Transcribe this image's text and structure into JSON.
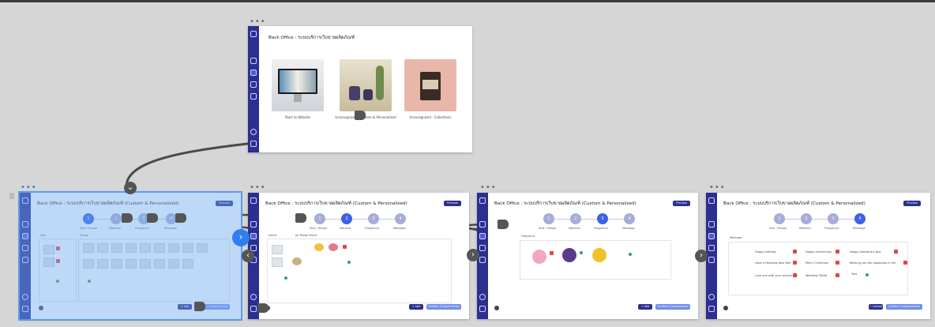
{
  "canvas": {
    "menu_glyph": "•••",
    "next_glyph": "›",
    "back_glyph": "‹",
    "down_glyph": "⌄"
  },
  "top_card": {
    "title": "Back Office : ระบบบริการเว็บขายผลิตภัณฑ์",
    "products": [
      {
        "label": "Start to Website"
      },
      {
        "label": "Unrecognized · Custom & Personalized"
      },
      {
        "label": "Unrecognized · Collections"
      }
    ]
  },
  "flow_cards": [
    {
      "title": "Back Office : ระบบบริการเว็บขายผลิตภัณฑ์ (Custom & Personalized)",
      "button": "Preview",
      "active_step": 1,
      "section_a": "Size",
      "section_b": "Shape",
      "actions": [
        "+ Add",
        "Confirm Customization"
      ]
    },
    {
      "title": "Back Office : ระบบบริการเว็บขายผลิตภัณฑ์ (Custom & Personalized)",
      "button": "Preview",
      "active_step": 2,
      "section_a": "Select",
      "section_b": "Jar Pastel Mood",
      "actions": [
        "+ Add",
        "Confirm Customization"
      ]
    },
    {
      "title": "Back Office : ระบบบริการเว็บขายผลิตภัณฑ์ (Custom & Personalized)",
      "button": "Preview",
      "active_step": 3,
      "section_a": "Fragrance",
      "section_b": "",
      "actions": [
        "+ Add",
        "Confirm Customization"
      ]
    },
    {
      "title": "Back Office : ระบบบริการเว็บขายผลิตภัณฑ์ (Custom & Personalized)",
      "button": "Preview",
      "active_step": 4,
      "section_a": "Message",
      "section_b": "",
      "messages": [
        "Happy birthday",
        "Happy Anniversary",
        "Happy Valentine's Day",
        "Have a Relaxing New Year",
        "Merry Christmas",
        "Wishing you the happiness in life",
        "Love you with your special day",
        "Wedding Gifted",
        "Text"
      ],
      "actions": [
        "+ Upload",
        "Confirm Customization"
      ]
    }
  ],
  "steps": [
    {
      "num": "1",
      "label": "Size / Shape"
    },
    {
      "num": "2",
      "label": "Material"
    },
    {
      "num": "3",
      "label": "Fragrance"
    },
    {
      "num": "4",
      "label": "Message"
    }
  ],
  "colors": {
    "sidebar": "#2b2f8f",
    "active_step": "#3b62e8",
    "selection": "#5b9cf0",
    "wire": "#4a4a4a"
  }
}
